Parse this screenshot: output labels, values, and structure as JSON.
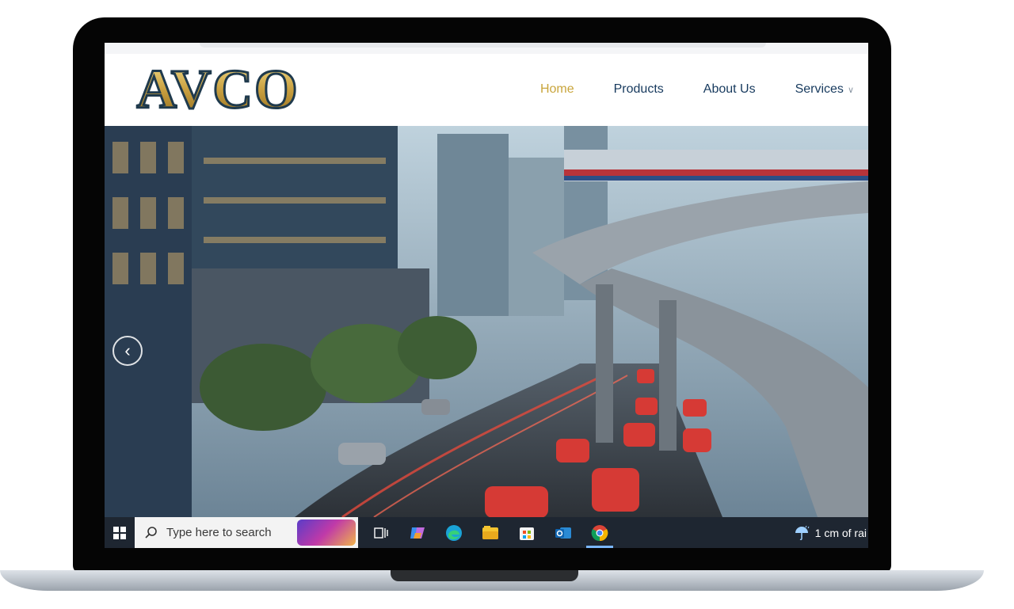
{
  "brand": {
    "logo_text": "AVCO"
  },
  "nav": {
    "items": [
      {
        "label": "Home",
        "active": true
      },
      {
        "label": "Products",
        "active": false
      },
      {
        "label": "About Us",
        "active": false
      },
      {
        "label": "Services",
        "active": false,
        "dropdown": true
      }
    ]
  },
  "hero": {
    "prev_icon": "chevron-left-icon"
  },
  "taskbar": {
    "search_placeholder": "Type here to search",
    "weather": "1 cm of rai",
    "apps": [
      "task-view",
      "copilot",
      "edge",
      "file-explorer",
      "microsoft-store",
      "outlook",
      "chrome"
    ]
  },
  "colors": {
    "accent_gold": "#c9a53c",
    "nav_blue": "#173a5e",
    "taskbar": "#1e2631"
  }
}
